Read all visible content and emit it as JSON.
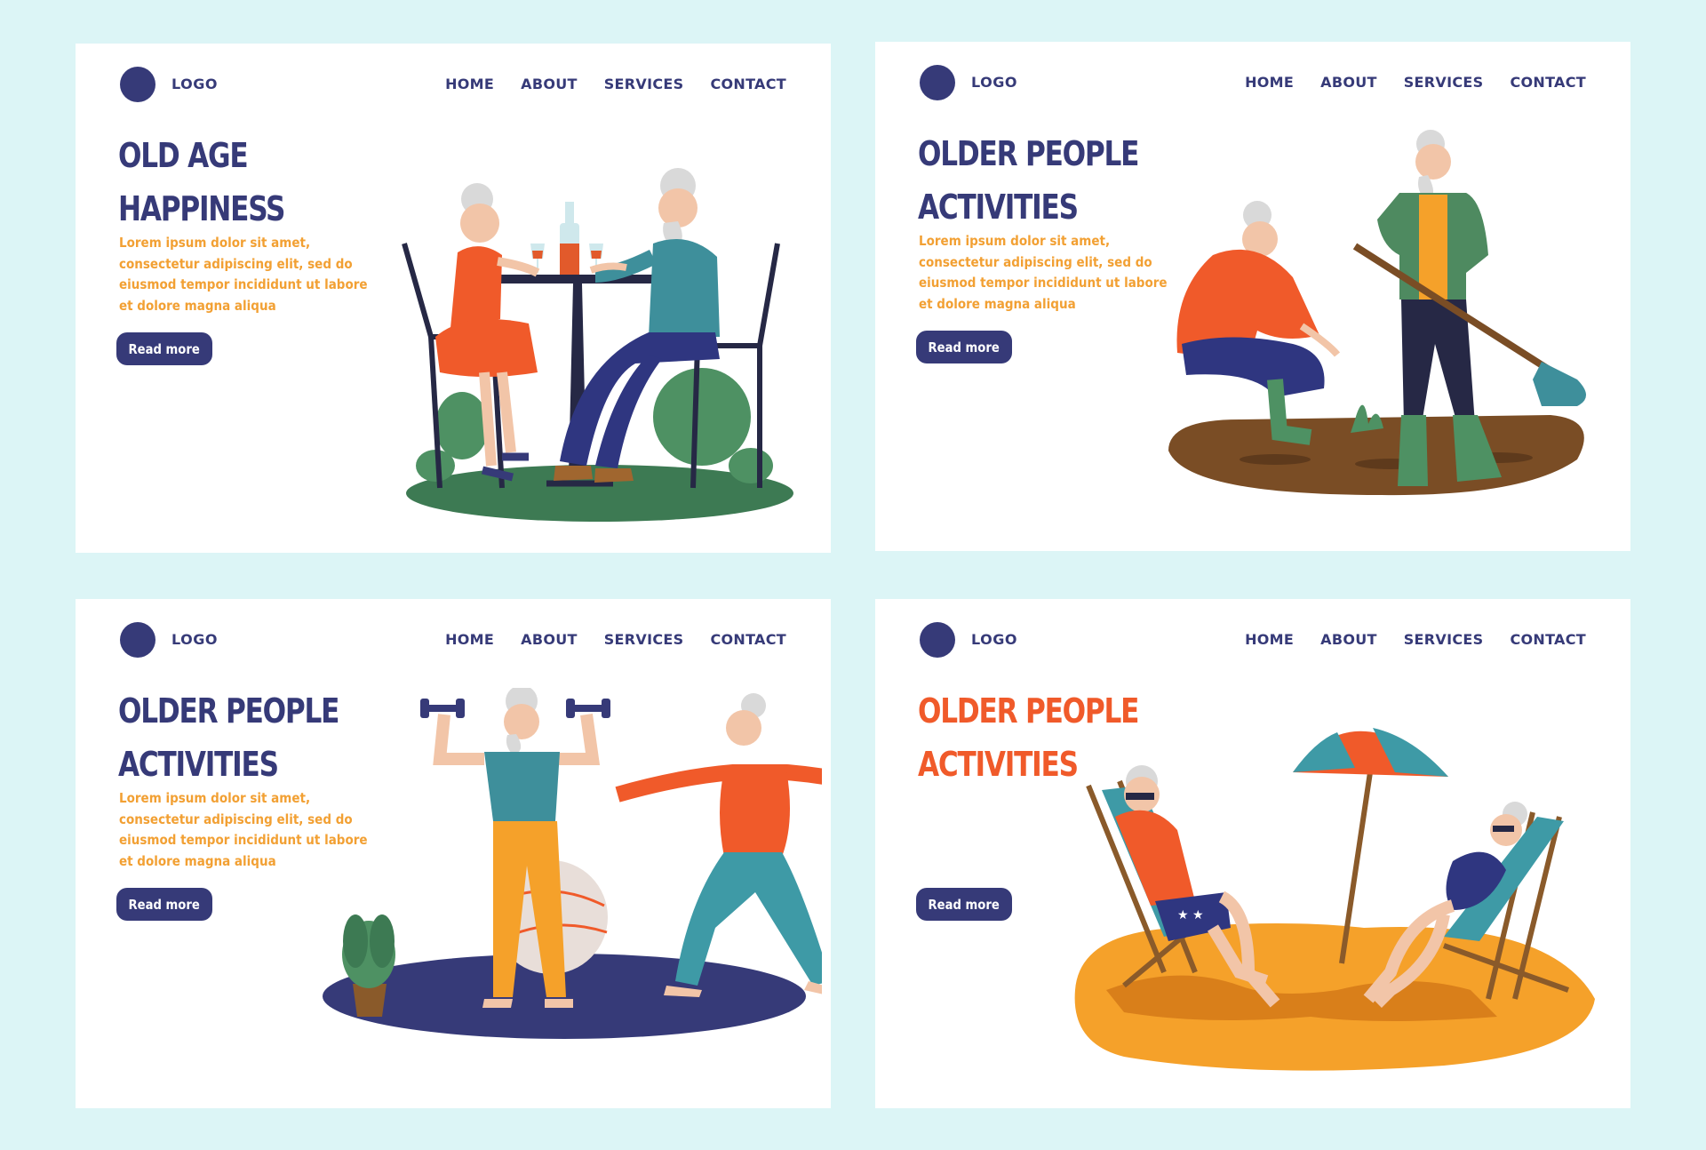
{
  "nav": {
    "logo": "LOGO",
    "items": [
      "HOME",
      "ABOUT",
      "SERVICES",
      "CONTACT"
    ]
  },
  "cards": [
    {
      "title_line1": "OLD AGE",
      "title_line2": "HAPPINESS",
      "title_color": "#363a78",
      "description": "Lorem ipsum dolor sit amet, consectetur adipiscing elit, sed do eiusmod tempor incididunt ut labore et dolore magna aliqua",
      "button": "Read more",
      "illustration": "elderly-couple-cafe-table"
    },
    {
      "title_line1": "OLDER PEOPLE",
      "title_line2": "ACTIVITIES",
      "title_color": "#363a78",
      "description": "Lorem ipsum dolor sit amet, consectetur adipiscing elit, sed do eiusmod tempor incididunt ut labore et dolore magna aliqua",
      "button": "Read more",
      "illustration": "elderly-couple-gardening"
    },
    {
      "title_line1": "OLDER PEOPLE",
      "title_line2": "ACTIVITIES",
      "title_color": "#363a78",
      "description": "Lorem ipsum dolor sit amet, consectetur adipiscing elit, sed do eiusmod tempor incididunt ut labore et dolore magna aliqua",
      "button": "Read more",
      "illustration": "elderly-couple-exercise"
    },
    {
      "title_line1": "OLDER PEOPLE",
      "title_line2": "ACTIVITIES",
      "title_color": "#f05a2a",
      "description": "",
      "button": "Read more",
      "illustration": "elderly-couple-beach"
    }
  ],
  "colors": {
    "background": "#dcf5f6",
    "navy": "#363a78",
    "orange_text": "#f2a033",
    "red_orange": "#f05a2a"
  }
}
